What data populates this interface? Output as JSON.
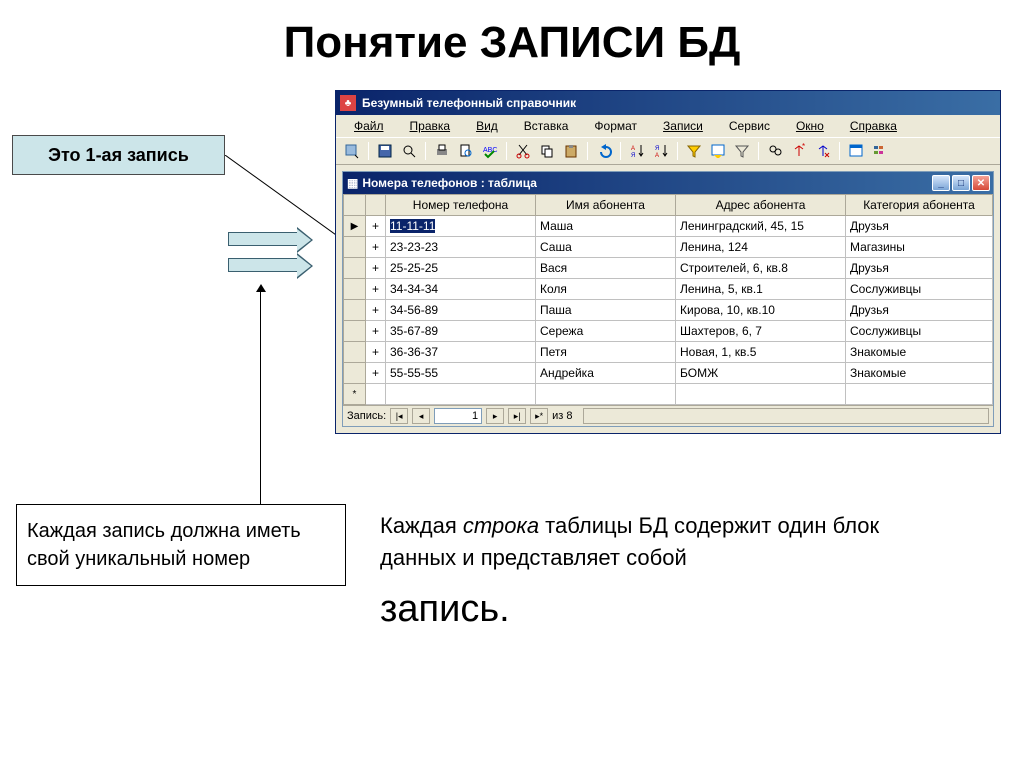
{
  "title": {
    "first": "Понятие ",
    "bold": "ЗАПИСИ ",
    "last": "БД"
  },
  "callout": "Это 1-ая запись",
  "app": {
    "titlebar": "Безумный телефонный справочник",
    "menus": [
      "Файл",
      "Правка",
      "Вид",
      "Вставка",
      "Формат",
      "Записи",
      "Сервис",
      "Окно",
      "Справка"
    ]
  },
  "tablewin": {
    "title": "Номера телефонов : таблица",
    "headers": [
      "Номер телефона",
      "Имя абонента",
      "Адрес абонента",
      "Категория абонента"
    ],
    "rows": [
      {
        "phone": "11-11-11",
        "name": "Маша",
        "addr": "Ленинградский, 45, 15",
        "cat": "Друзья",
        "selected": true,
        "current": true
      },
      {
        "phone": "23-23-23",
        "name": "Саша",
        "addr": "Ленина, 124",
        "cat": "Магазины"
      },
      {
        "phone": "25-25-25",
        "name": "Вася",
        "addr": "Строителей, 6, кв.8",
        "cat": "Друзья"
      },
      {
        "phone": "34-34-34",
        "name": "Коля",
        "addr": "Ленина, 5, кв.1",
        "cat": "Сослуживцы"
      },
      {
        "phone": "34-56-89",
        "name": "Паша",
        "addr": "Кирова, 10, кв.10",
        "cat": "Друзья"
      },
      {
        "phone": "35-67-89",
        "name": "Сережа",
        "addr": "Шахтеров, 6, 7",
        "cat": "Сослуживцы"
      },
      {
        "phone": "36-36-37",
        "name": "Петя",
        "addr": "Новая, 1, кв.5",
        "cat": "Знакомые"
      },
      {
        "phone": "55-55-55",
        "name": "Андрейка",
        "addr": "БОМЖ",
        "cat": "Знакомые"
      }
    ],
    "nav": {
      "label": "Запись:",
      "current": "1",
      "of": "из  8"
    }
  },
  "bottom_left": "Каждая запись должна иметь свой уникальный номер",
  "bottom_right": {
    "line1a": "Каждая ",
    "line1b": "строка",
    "line1c": " таблицы БД содержит один блок данных и представляет собой",
    "big": "запись."
  }
}
